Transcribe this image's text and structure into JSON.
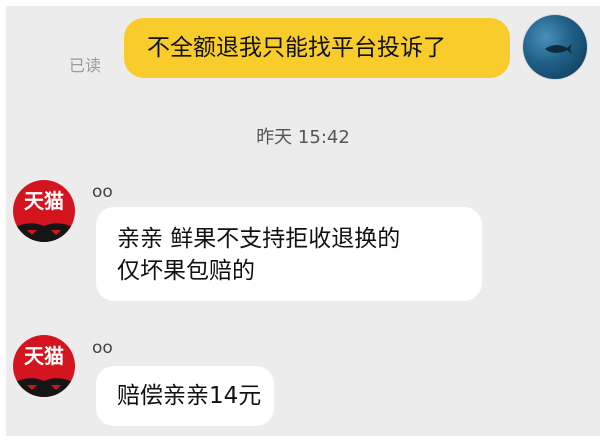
{
  "conversation": {
    "outgoing": {
      "text": "不全额退我只能找平台投诉了",
      "read_status": "已读",
      "bubble_color": "#f8cc2b"
    },
    "timestamp": "昨天  15:42",
    "incoming": [
      {
        "sender": "oo",
        "avatar_label": "天猫",
        "lines": [
          "亲亲 鲜果不支持拒收退换的",
          "仅坏果包赔的"
        ]
      },
      {
        "sender": "oo",
        "avatar_label": "天猫",
        "lines": [
          "赔偿亲亲14元"
        ]
      }
    ]
  },
  "colors": {
    "background": "#ececec",
    "tmall_red": "#d4141f",
    "incoming_bubble": "#ffffff"
  },
  "icons": {
    "outgoing_avatar": "ocean-fish-avatar",
    "incoming_avatar": "tmall-cat-avatar"
  }
}
